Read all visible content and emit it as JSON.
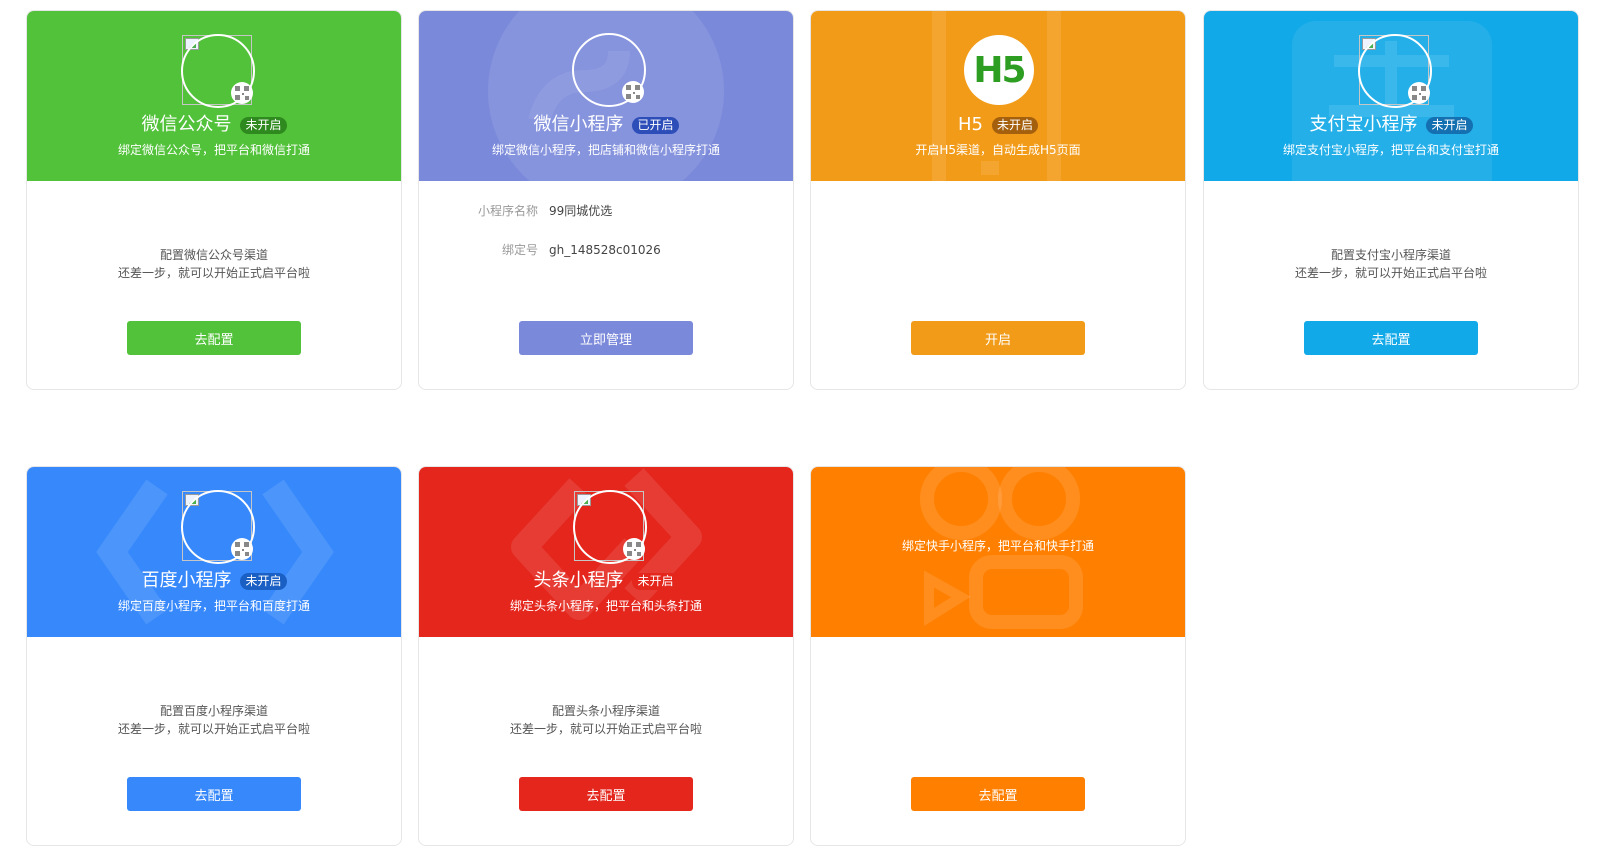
{
  "cards": {
    "wechat_oa": {
      "title": "微信公众号",
      "status": "未开启",
      "subtitle": "绑定微信公众号，把平台和微信打通",
      "desc_line1": "配置微信公众号渠道",
      "desc_line2": "还差一步，就可以开始正式启平台啦",
      "button": "去配置",
      "color": "#52c23a",
      "icon": "qr-code-icon"
    },
    "wechat_mp": {
      "title": "微信小程序",
      "status": "已开启",
      "subtitle": "绑定微信小程序，把店铺和微信小程序打通",
      "info": [
        {
          "label": "小程序名称",
          "value": "99同城优选"
        },
        {
          "label": "绑定号",
          "value": "gh_148528c01026"
        }
      ],
      "button": "立即管理",
      "color": "#7b89da",
      "icon": "qr-code-icon"
    },
    "h5": {
      "title": "H5",
      "status": "未开启",
      "subtitle": "开启H5渠道，自动生成H5页面",
      "logo": "H5",
      "button": "开启",
      "color": "#f29b18"
    },
    "alipay_mp": {
      "title": "支付宝小程序",
      "status": "未开启",
      "subtitle": "绑定支付宝小程序，把平台和支付宝打通",
      "desc_line1": "配置支付宝小程序渠道",
      "desc_line2": "还差一步，就可以开始正式启平台啦",
      "button": "去配置",
      "color": "#12a9e8",
      "icon": "qr-code-icon"
    },
    "baidu_mp": {
      "title": "百度小程序",
      "status": "未开启",
      "subtitle": "绑定百度小程序，把平台和百度打通",
      "desc_line1": "配置百度小程序渠道",
      "desc_line2": "还差一步，就可以开始正式启平台啦",
      "button": "去配置",
      "color": "#3789fb",
      "icon": "qr-code-icon"
    },
    "toutiao_mp": {
      "title": "头条小程序",
      "status": "未开启",
      "subtitle": "绑定头条小程序，把平台和头条打通",
      "desc_line1": "配置头条小程序渠道",
      "desc_line2": "还差一步，就可以开始正式启平台啦",
      "button": "去配置",
      "color": "#e4261d",
      "icon": "qr-code-icon"
    },
    "kuaishou_mp": {
      "subtitle": "绑定快手小程序，把平台和快手打通",
      "button": "去配置",
      "color": "#ff7f00"
    }
  }
}
